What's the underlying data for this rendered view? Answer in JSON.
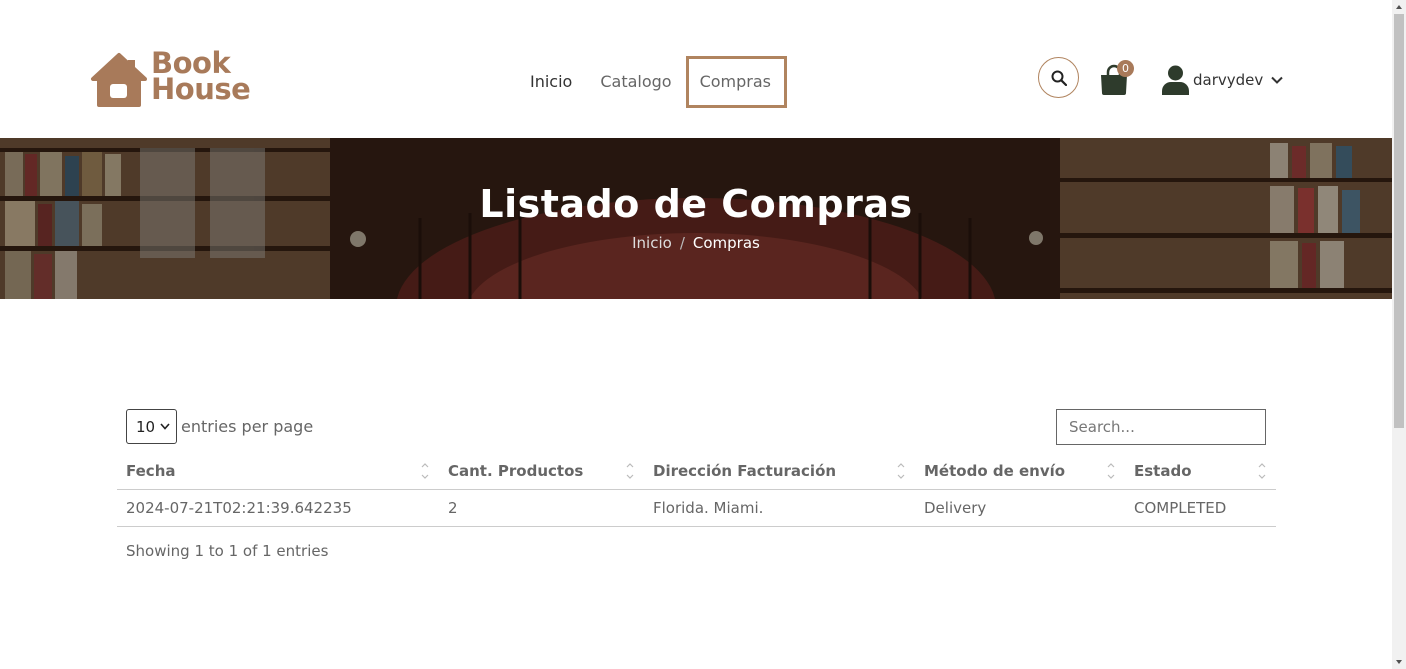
{
  "brand": {
    "line1": "Book",
    "line2": "House",
    "color": "#a87a5a"
  },
  "nav": {
    "items": [
      "Inicio",
      "Catalogo",
      "Compras"
    ],
    "active_index": 2
  },
  "cart": {
    "count": "0"
  },
  "user": {
    "name": "darvydev"
  },
  "hero": {
    "title": "Listado de Compras",
    "breadcrumb": [
      "Inicio",
      "/",
      "Compras"
    ]
  },
  "table_controls": {
    "entries_value": "10",
    "entries_label": "entries per page",
    "search_placeholder": "Search..."
  },
  "table": {
    "headers": [
      "Fecha",
      "Cant. Productos",
      "Dirección Facturación",
      "Método de envío",
      "Estado"
    ],
    "rows": [
      [
        "2024-07-21T02:21:39.642235",
        "2",
        "Florida. Miami.",
        "Delivery",
        "COMPLETED"
      ]
    ]
  },
  "info": "Showing 1 to 1 of 1 entries",
  "colors": {
    "accent": "#b0845f",
    "dark_icon": "#2e3b2c"
  }
}
